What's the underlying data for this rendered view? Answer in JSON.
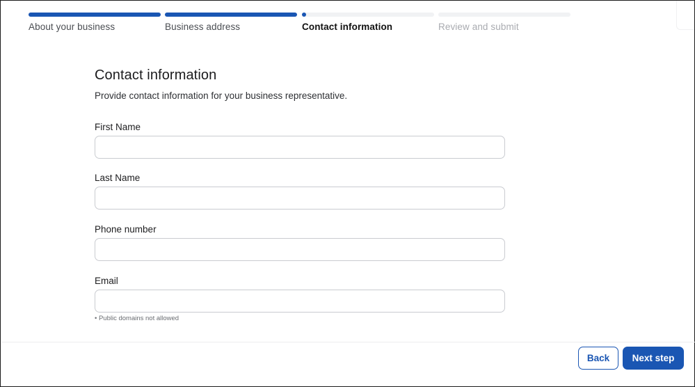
{
  "stepper": {
    "steps": [
      {
        "label": "About your business",
        "status": "complete",
        "progress": 1.0
      },
      {
        "label": "Business address",
        "status": "complete",
        "progress": 1.0
      },
      {
        "label": "Contact information",
        "status": "current",
        "progress": 0.0
      },
      {
        "label": "Review and submit",
        "status": "upcoming",
        "progress": 0.0
      }
    ]
  },
  "form": {
    "title": "Contact information",
    "subtitle": "Provide contact information for your business representative.",
    "fields": [
      {
        "label": "First Name",
        "value": "",
        "placeholder": ""
      },
      {
        "label": "Last Name",
        "value": "",
        "placeholder": ""
      },
      {
        "label": "Phone number",
        "value": "",
        "placeholder": ""
      },
      {
        "label": "Email",
        "value": "",
        "placeholder": "",
        "hint": "• Public domains not allowed"
      }
    ]
  },
  "footer": {
    "back_label": "Back",
    "next_label": "Next step"
  },
  "colors": {
    "accent": "#1a56b3",
    "inactive_track": "#f1f2f4",
    "input_border": "#c9cbd0"
  }
}
